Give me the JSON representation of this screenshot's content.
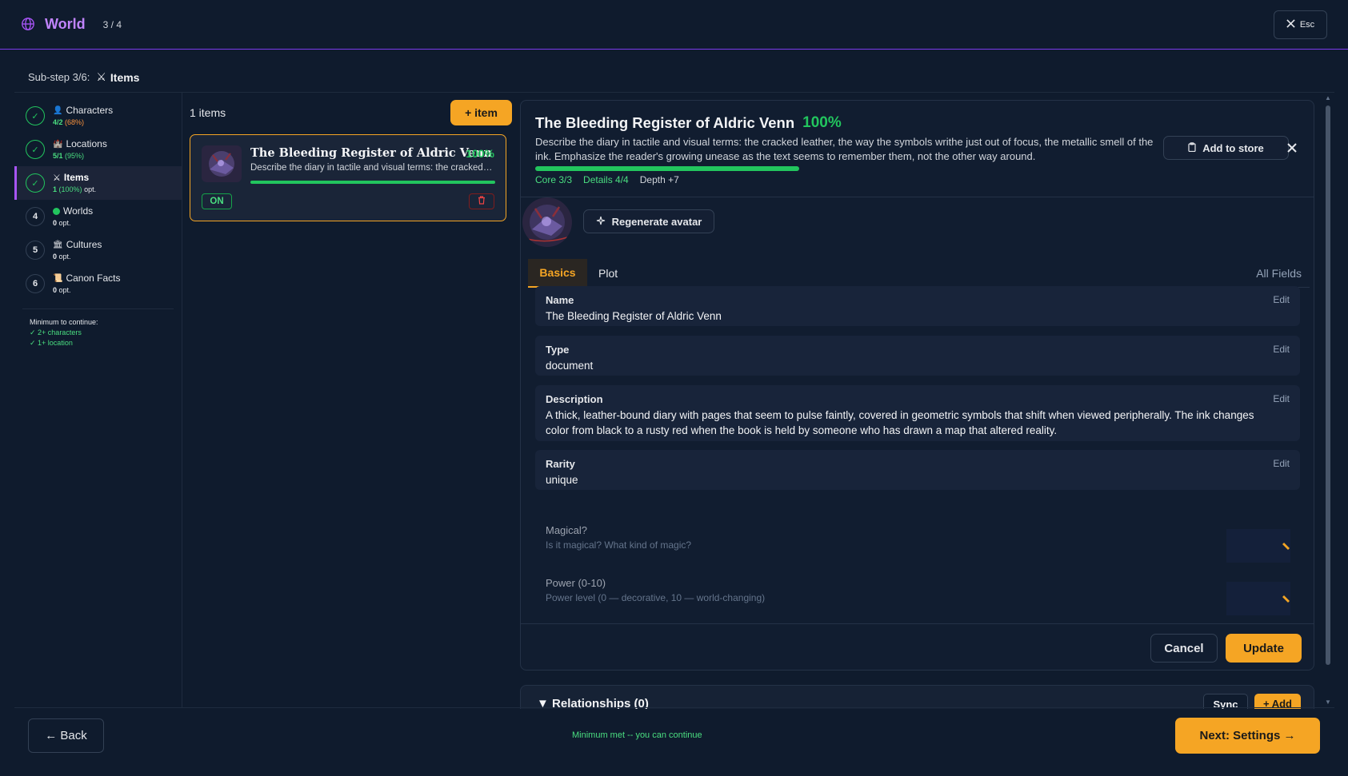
{
  "header": {
    "title": "World",
    "progress": "3 / 4",
    "esc_label": "Esc"
  },
  "substep": {
    "label": "Sub-step 3/6:",
    "current": "Items"
  },
  "sidebar": {
    "steps": [
      {
        "label": "Characters",
        "count": "4/2",
        "pct": "(68%)",
        "status": "done",
        "icon": "person-icon"
      },
      {
        "label": "Locations",
        "count": "5/1",
        "pct": "(95%)",
        "status": "done",
        "icon": "castle-icon"
      },
      {
        "label": "Items",
        "count": "1",
        "pct": "(100%)",
        "opt": "opt.",
        "status": "done",
        "icon": "crossed-swords-icon"
      },
      {
        "label": "Worlds",
        "num": "4",
        "count": "0",
        "opt": "opt.",
        "icon": "globe-icon"
      },
      {
        "label": "Cultures",
        "num": "5",
        "count": "0",
        "opt": "opt.",
        "icon": "temple-icon"
      },
      {
        "label": "Canon Facts",
        "num": "6",
        "count": "0",
        "opt": "opt.",
        "icon": "scroll-icon"
      }
    ],
    "minimum": {
      "title": "Minimum to continue:",
      "req1": "✓ 2+ characters",
      "req2": "✓ 1+ location"
    }
  },
  "items_list": {
    "count_label": "1 items",
    "add_label": "+ item",
    "card": {
      "name": "The Bleeding Register of Aldric Venn",
      "pct": "100%",
      "progress": 1.0,
      "desc": "Describe the diary in tactile and visual terms: the cracked leather, the way the symbols writhe just out of focus, the metallic smell of the ink.",
      "on_label": "ON"
    }
  },
  "detail": {
    "title": "The Bleeding Register of Aldric Venn",
    "pct": "100%",
    "desc": "Describe the diary in tactile and visual terms: the cracked leather, the way the symbols writhe just out of focus, the metallic smell of the ink. Emphasize the reader's growing unease as the text seems to remember them, not the other way around.",
    "progress": 1.0,
    "core": "Core 3/3",
    "details": "Details 4/4",
    "depth": "Depth +7",
    "store_label": "Add to store",
    "regen_label": "Regenerate avatar",
    "tabs": {
      "basics": "Basics",
      "plot": "Plot",
      "all": "All Fields"
    },
    "fields": [
      {
        "label": "Name",
        "value": "The Bleeding Register of Aldric Venn",
        "edit": "Edit"
      },
      {
        "label": "Type",
        "value": "document",
        "edit": "Edit"
      },
      {
        "label": "Description",
        "value": "A thick, leather-bound diary with pages that seem to pulse faintly, covered in geometric symbols that shift when viewed peripherally. The ink changes color from black to a rusty red when the book is held by someone who has drawn a map that altered reality.",
        "edit": "Edit"
      },
      {
        "label": "Rarity",
        "value": "unique",
        "edit": "Edit"
      }
    ],
    "empty_fields": [
      {
        "label": "Magical?",
        "hint": "Is it magical? What kind of magic?"
      },
      {
        "label": "Power (0-10)",
        "hint": "Power level (0 — decorative, 10 — world-changing)"
      }
    ],
    "cancel_label": "Cancel",
    "update_label": "Update"
  },
  "relationships": {
    "title": "▼ Relationships (0)",
    "sync_label": "Sync",
    "add_label": "+ Add"
  },
  "footer": {
    "back_label": "← Back",
    "message": "Minimum met -- you can continue",
    "next_label": "Next: Settings →"
  },
  "colors": {
    "accent": "#f5a524",
    "success": "#22c55e",
    "brand": "#a855f7",
    "background": "#0f1b2d"
  }
}
